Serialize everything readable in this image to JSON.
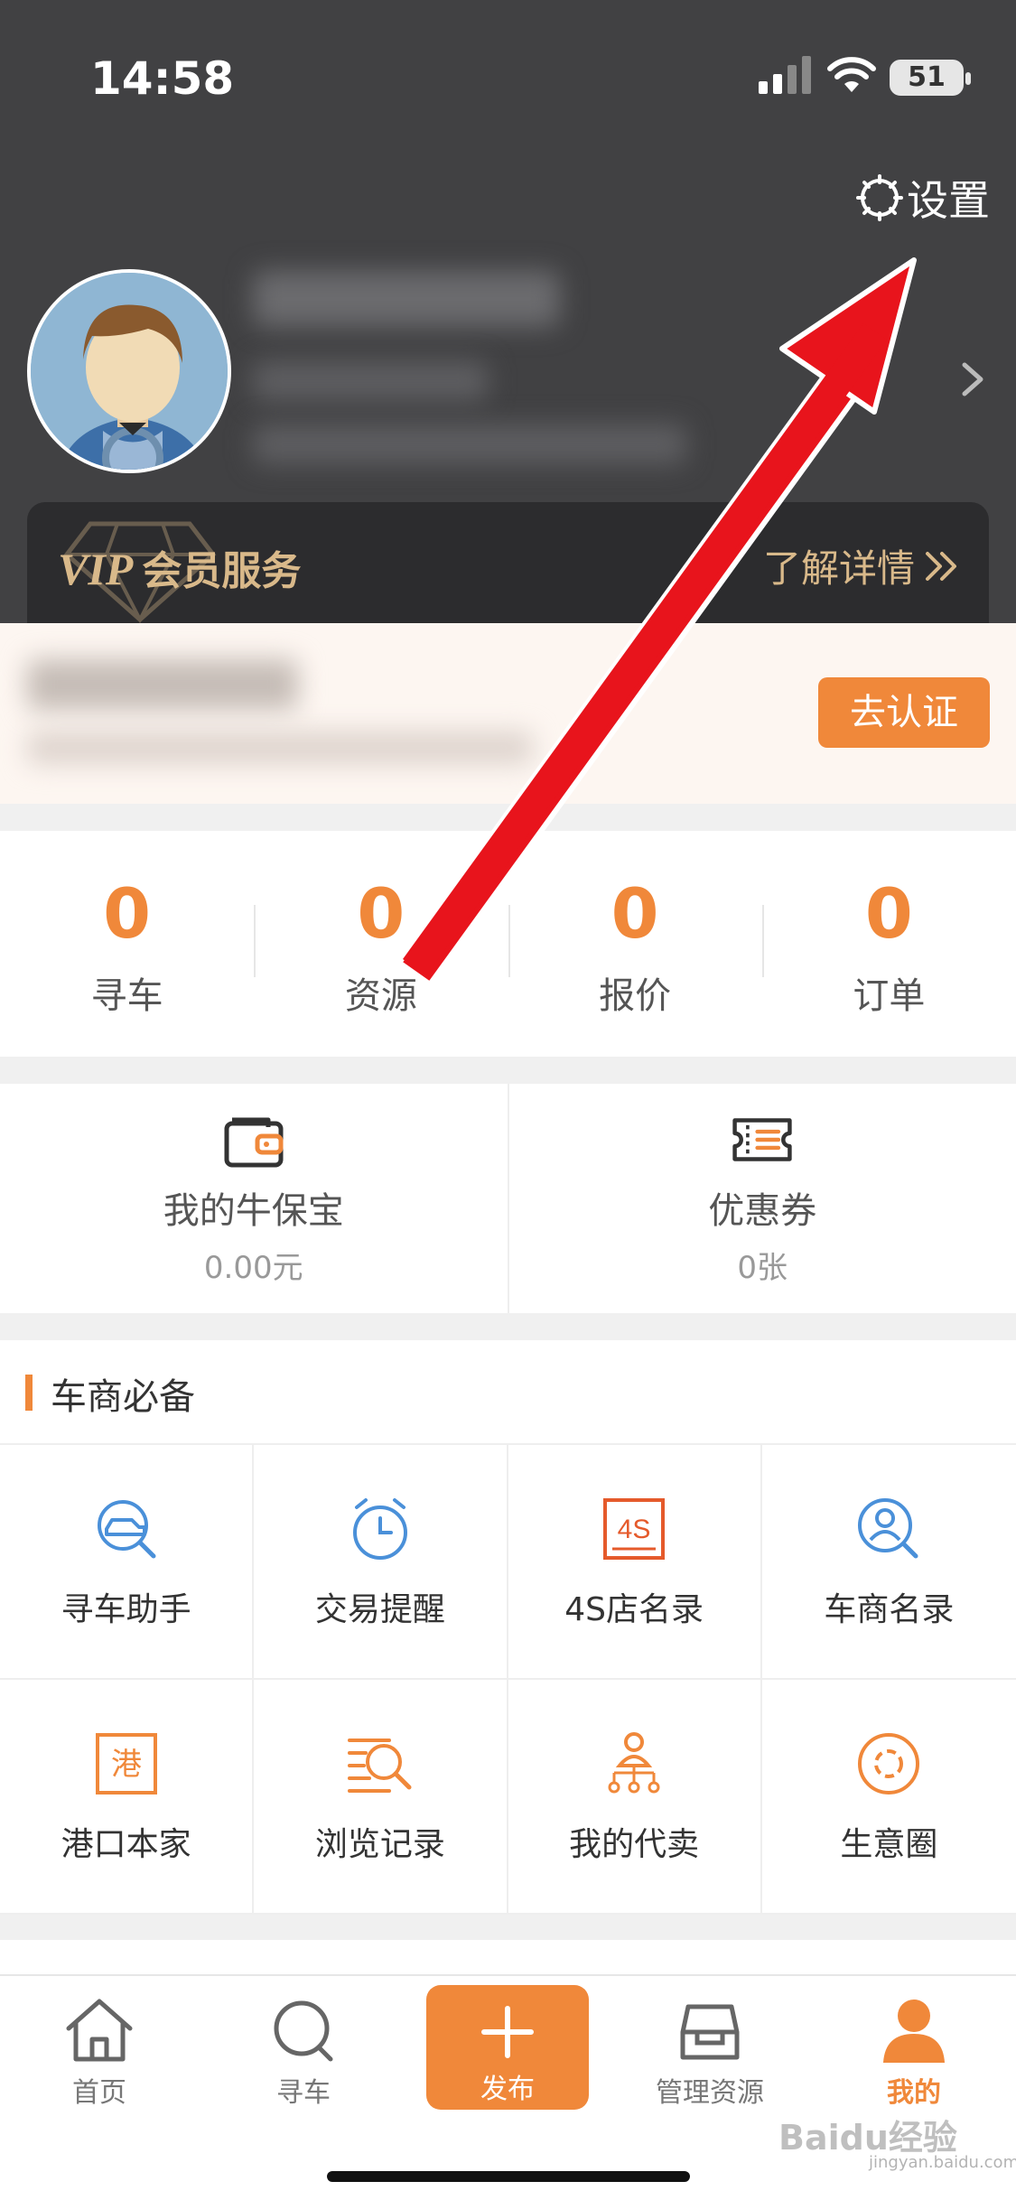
{
  "status_bar": {
    "time": "14:58",
    "battery": "51"
  },
  "header": {
    "settings_label": "设置",
    "vip": {
      "mark": "VIP",
      "title": "会员服务",
      "details": "了解详情"
    }
  },
  "certification": {
    "button": "去认证"
  },
  "stats": [
    {
      "value": "0",
      "label": "寻车"
    },
    {
      "value": "0",
      "label": "资源"
    },
    {
      "value": "0",
      "label": "报价"
    },
    {
      "value": "0",
      "label": "订单"
    }
  ],
  "wallet": [
    {
      "label": "我的牛保宝",
      "sub": "0.00元",
      "icon": "wallet-icon"
    },
    {
      "label": "优惠券",
      "sub": "0张",
      "icon": "coupon-icon"
    }
  ],
  "tools": {
    "title": "车商必备",
    "items": [
      {
        "label": "寻车助手",
        "icon": "car-search-icon"
      },
      {
        "label": "交易提醒",
        "icon": "alarm-clock-icon"
      },
      {
        "label": "4S店名录",
        "icon": "4s-store-icon"
      },
      {
        "label": "车商名录",
        "icon": "dealer-search-icon"
      },
      {
        "label": "港口本家",
        "icon": "port-icon"
      },
      {
        "label": "浏览记录",
        "icon": "history-icon"
      },
      {
        "label": "我的代卖",
        "icon": "consignment-icon"
      },
      {
        "label": "生意圈",
        "icon": "business-circle-icon"
      }
    ]
  },
  "tabbar": [
    {
      "label": "首页",
      "icon": "home-icon"
    },
    {
      "label": "寻车",
      "icon": "search-icon"
    },
    {
      "label": "发布",
      "icon": "plus-icon"
    },
    {
      "label": "管理资源",
      "icon": "car-manage-icon"
    },
    {
      "label": "我的",
      "icon": "profile-icon",
      "active": true
    }
  ],
  "watermark": {
    "text": "Baidu经验",
    "sub": "jingyan.baidu.com"
  },
  "colors": {
    "accent": "#f0883a",
    "header_bg": "#414143",
    "vip_gold": "#d9b98a",
    "annotation_arrow": "#e8141c"
  }
}
